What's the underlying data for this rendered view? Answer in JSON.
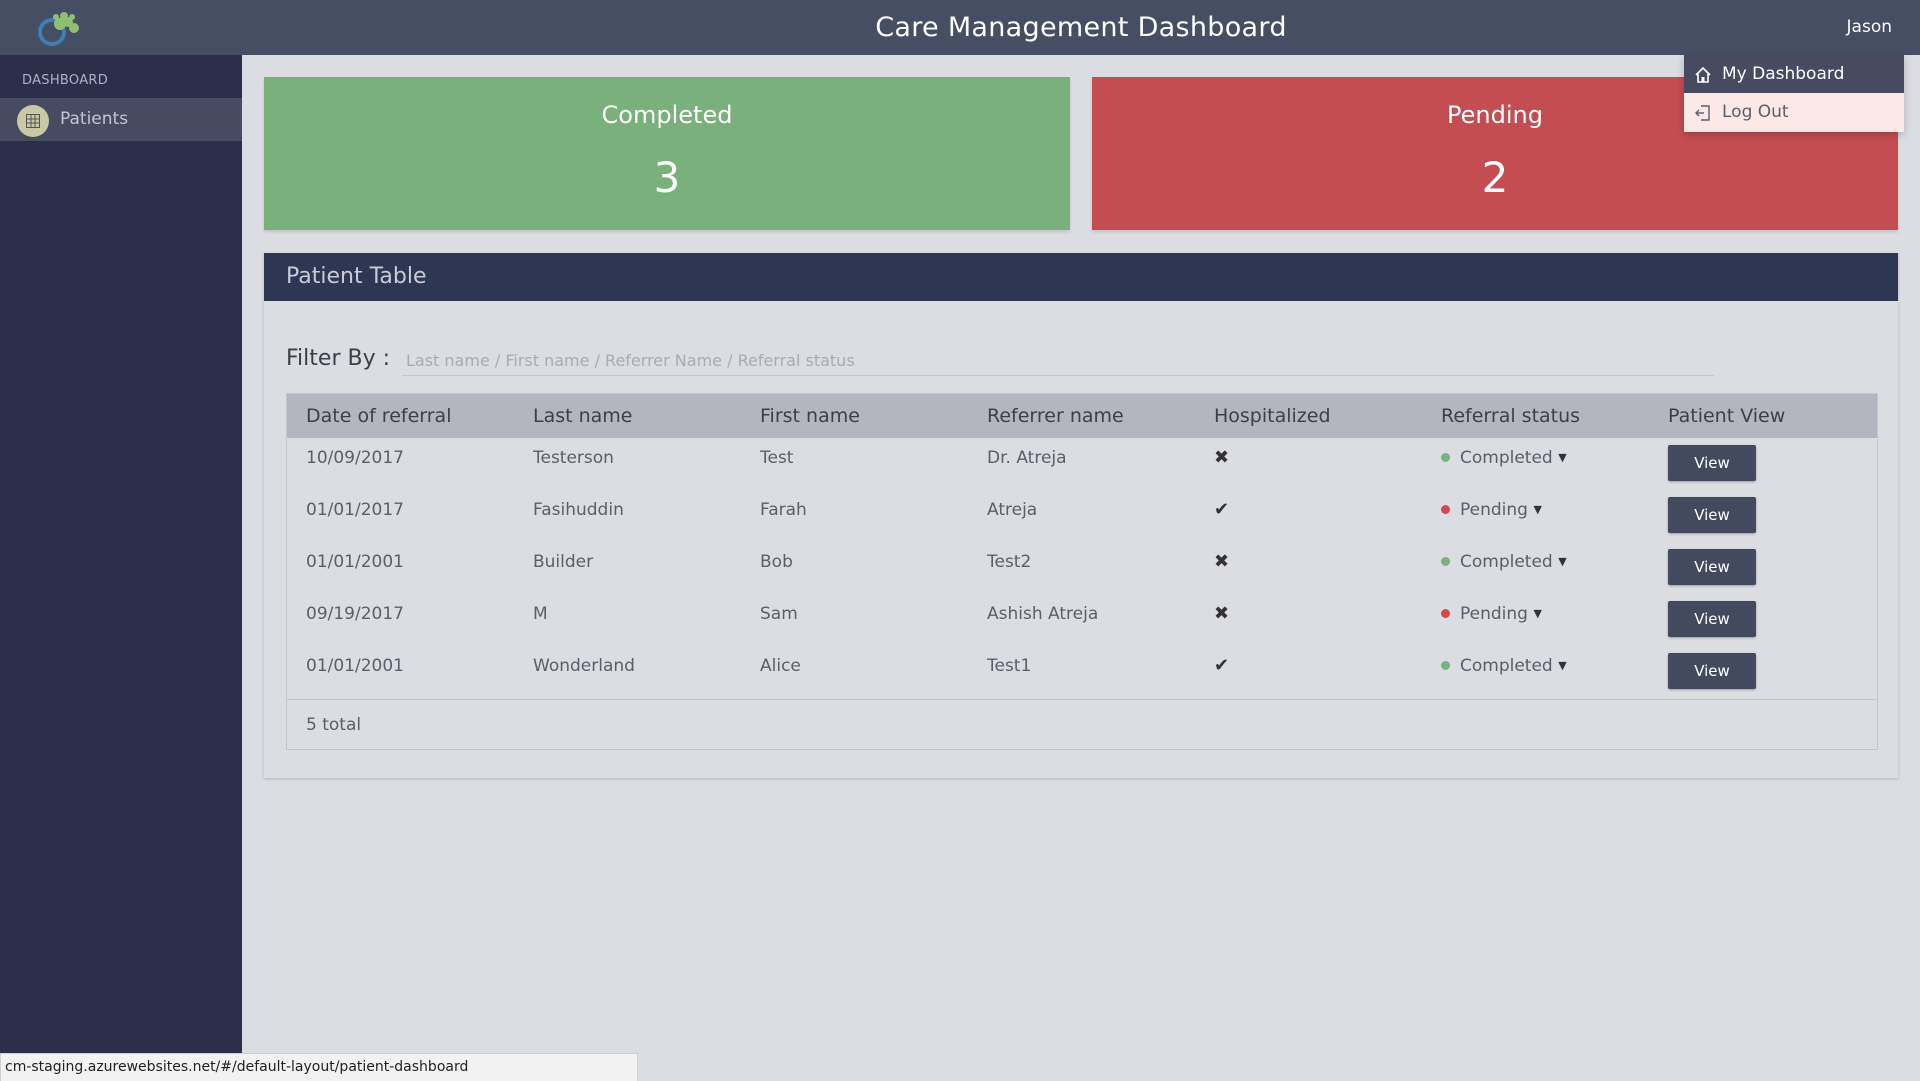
{
  "header": {
    "title": "Care Management Dashboard",
    "user": "Jason"
  },
  "sidebar": {
    "heading": "DASHBOARD",
    "items": [
      {
        "label": "Patients",
        "icon": "table-icon"
      }
    ]
  },
  "cards": {
    "completed": {
      "title": "Completed",
      "value": "3",
      "color": "#79b07c"
    },
    "pending": {
      "title": "Pending",
      "value": "2",
      "color": "#c44d52"
    }
  },
  "panel": {
    "title": "Patient Table",
    "filter_label": "Filter By :",
    "filter_placeholder": "Last name / First name / Referrer Name / Referral status",
    "filter_value": ""
  },
  "table": {
    "columns": [
      "Date of referral",
      "Last name",
      "First name",
      "Referrer name",
      "Hospitalized",
      "Referral status",
      "Patient View"
    ],
    "rows": [
      {
        "date": "10/09/2017",
        "last": "Testerson",
        "first": "Test",
        "referrer": "Dr. Atreja",
        "hospitalized": "✖",
        "status": "Completed",
        "view": "View"
      },
      {
        "date": "01/01/2017",
        "last": "Fasihuddin",
        "first": "Farah",
        "referrer": "Atreja",
        "hospitalized": "✔",
        "status": "Pending",
        "view": "View"
      },
      {
        "date": "01/01/2001",
        "last": "Builder",
        "first": "Bob",
        "referrer": "Test2",
        "hospitalized": "✖",
        "status": "Completed",
        "view": "View"
      },
      {
        "date": "09/19/2017",
        "last": "M",
        "first": "Sam",
        "referrer": "Ashish Atreja",
        "hospitalized": "✖",
        "status": "Pending",
        "view": "View"
      },
      {
        "date": "01/01/2001",
        "last": "Wonderland",
        "first": "Alice",
        "referrer": "Test1",
        "hospitalized": "✔",
        "status": "Completed",
        "view": "View"
      }
    ],
    "total": "5 total",
    "status_colors": {
      "Completed": "#79b07c",
      "Pending": "#d9454a"
    }
  },
  "dropdown": {
    "items": [
      {
        "label": "My Dashboard",
        "icon": "home-icon"
      },
      {
        "label": "Log Out",
        "icon": "logout-icon"
      }
    ]
  },
  "statusbar": {
    "url": "cm-staging.azurewebsites.net/#/default-layout/patient-dashboard"
  }
}
